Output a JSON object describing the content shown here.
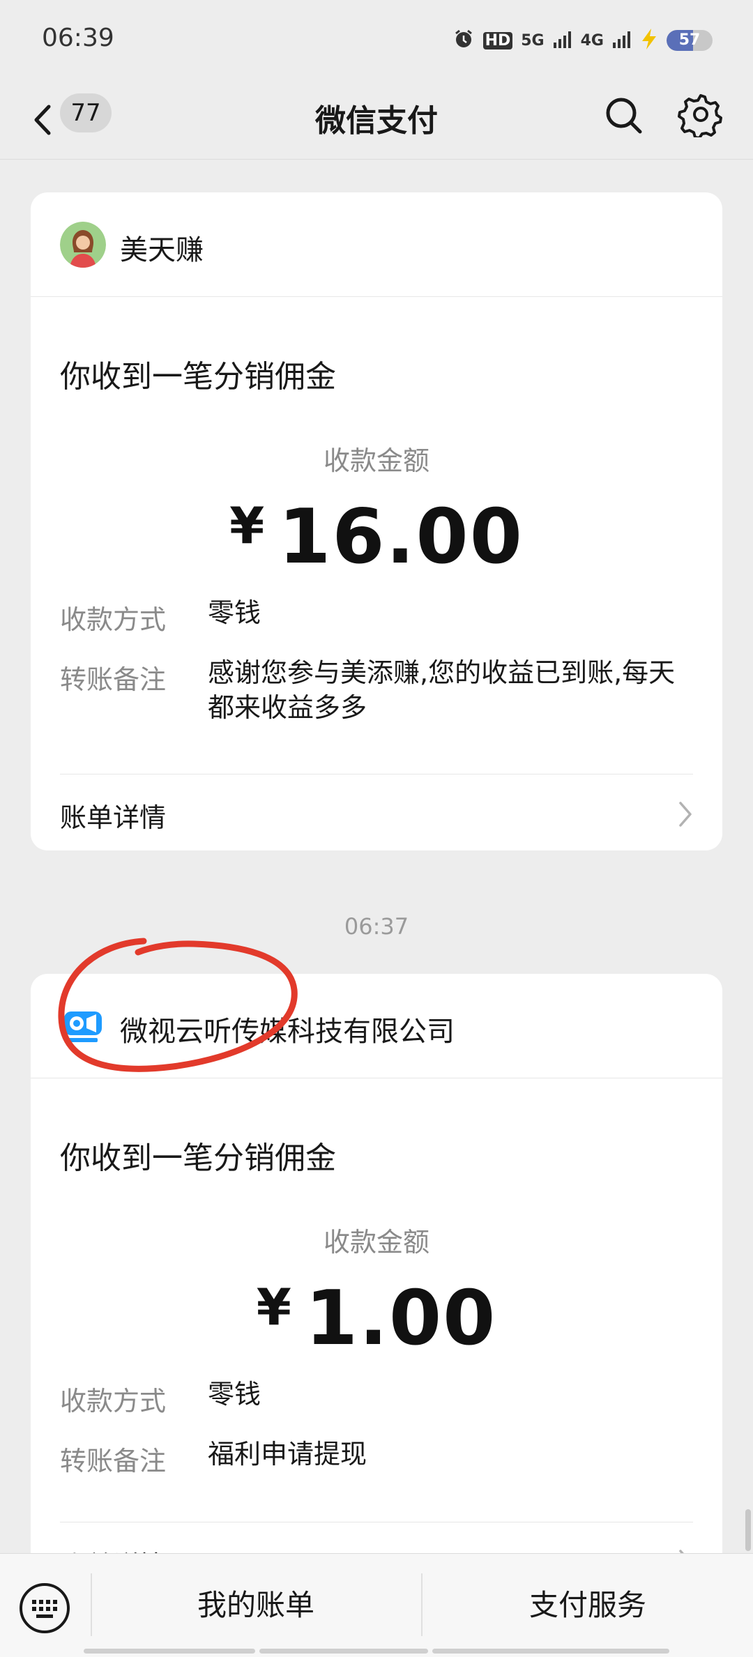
{
  "status_bar": {
    "time": "06:39",
    "network_1": "5G",
    "network_2": "4G",
    "hd": "HD",
    "battery": "57",
    "battery_level": 0.57
  },
  "nav": {
    "back_badge": "77",
    "title": "微信支付"
  },
  "messages": [
    {
      "merchant": "美天赚",
      "title": "你收到一笔分销佣金",
      "amount_label": "收款金额",
      "currency": "¥",
      "amount": "16.00",
      "method_label": "收款方式",
      "method_value": "零钱",
      "note_label": "转账备注",
      "note_value": "感谢您参与美添赚,您的收益已到账,每天都来收益多多",
      "detail_label": "账单详情"
    },
    {
      "timestamp": "06:37",
      "merchant": "微视云听传媒科技有限公司",
      "title": "你收到一笔分销佣金",
      "amount_label": "收款金额",
      "currency": "¥",
      "amount": "1.00",
      "method_label": "收款方式",
      "method_value": "零钱",
      "note_label": "转账备注",
      "note_value": "福利申请提现",
      "detail_label": "账单详情"
    }
  ],
  "bottom_bar": {
    "my_bills": "我的账单",
    "pay_services": "支付服务"
  },
  "colors": {
    "background": "#ededed",
    "card": "#ffffff",
    "annotation": "#e23a2b"
  }
}
